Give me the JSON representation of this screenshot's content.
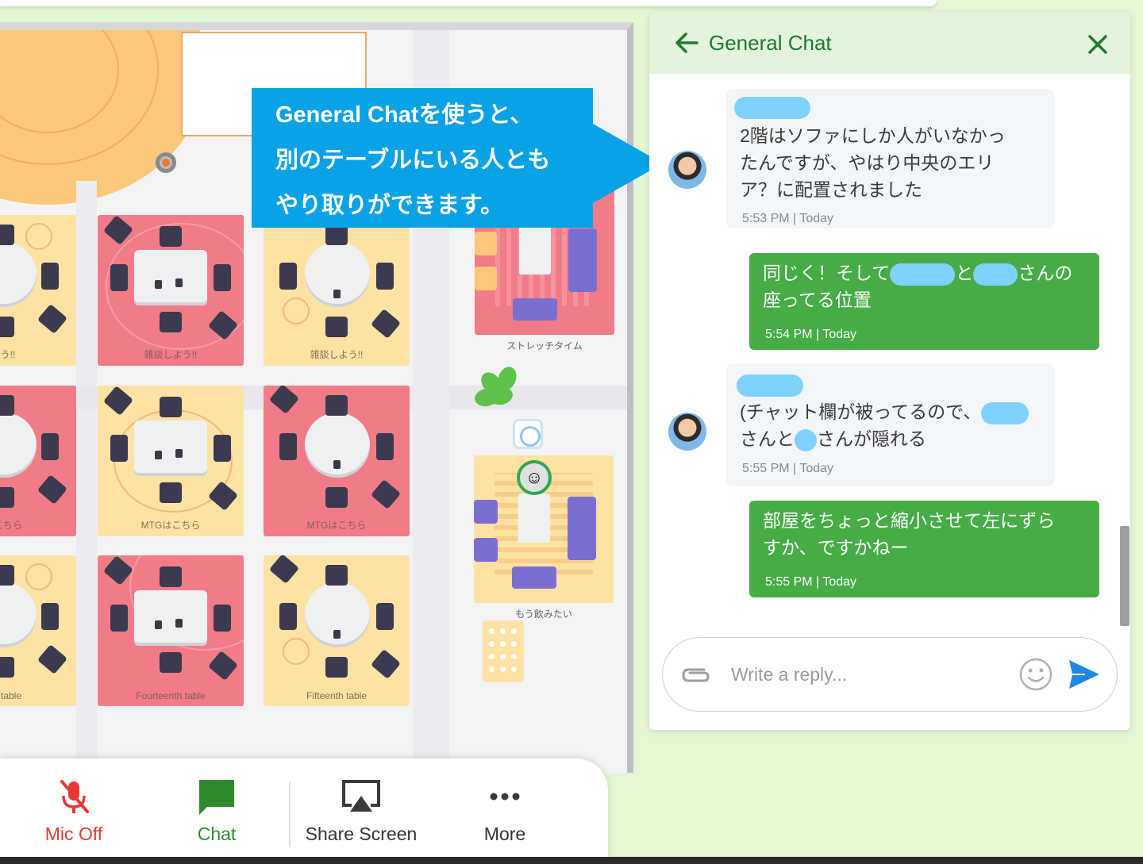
{
  "callout": {
    "line1": "General Chatを使うと、",
    "line2": "別のテーブルにいる人とも",
    "line3": "やり取りができます。"
  },
  "map": {
    "tables": [
      {
        "label": "よう!!",
        "color": "yellow"
      },
      {
        "label": "雑談しよう!!",
        "color": "red"
      },
      {
        "label": "雑談しよう!!",
        "color": "yellow"
      },
      {
        "label": "はこちら",
        "color": "red"
      },
      {
        "label": "MTGはこちら",
        "color": "yellow"
      },
      {
        "label": "MTGはこちら",
        "color": "red"
      },
      {
        "label": "nth table",
        "color": "yellow"
      },
      {
        "label": "Fourteenth table",
        "color": "red"
      },
      {
        "label": "Fifteenth table",
        "color": "yellow"
      }
    ],
    "lounge_pink_label": "ストレッチタイム",
    "lounge_cream_label": "もう飲みたい"
  },
  "toolbar": {
    "mic_label": "Mic Off",
    "chat_label": "Chat",
    "share_label": "Share Screen",
    "more_label": "More",
    "mic_color": "#e53935",
    "chat_color": "#2e8b2e"
  },
  "chat": {
    "title": "General Chat",
    "accent": "#1f7a2f",
    "messages": [
      {
        "direction": "incoming",
        "lines": [
          "2階はソファにしか人がいなかっ",
          "たんですが、やはり中央のエリ",
          "ア？に配置されました"
        ],
        "time": "5:53 PM | Today"
      },
      {
        "direction": "outgoing",
        "line1_a": "同じく！そして",
        "line1_b": "と",
        "line1_c": "さんの",
        "line2": "座ってる位置",
        "time": "5:54 PM | Today"
      },
      {
        "direction": "incoming",
        "line1": "(チャット欄が被ってるので、",
        "line2_a": "さんと",
        "line2_b": "さんが隠れる",
        "time": "5:55 PM | Today"
      },
      {
        "direction": "outgoing",
        "lines": [
          "部屋をちょっと縮小させて左にずら",
          "すか、ですかねー"
        ],
        "time": "5:55 PM | Today"
      }
    ],
    "reply_placeholder": "Write a reply..."
  }
}
